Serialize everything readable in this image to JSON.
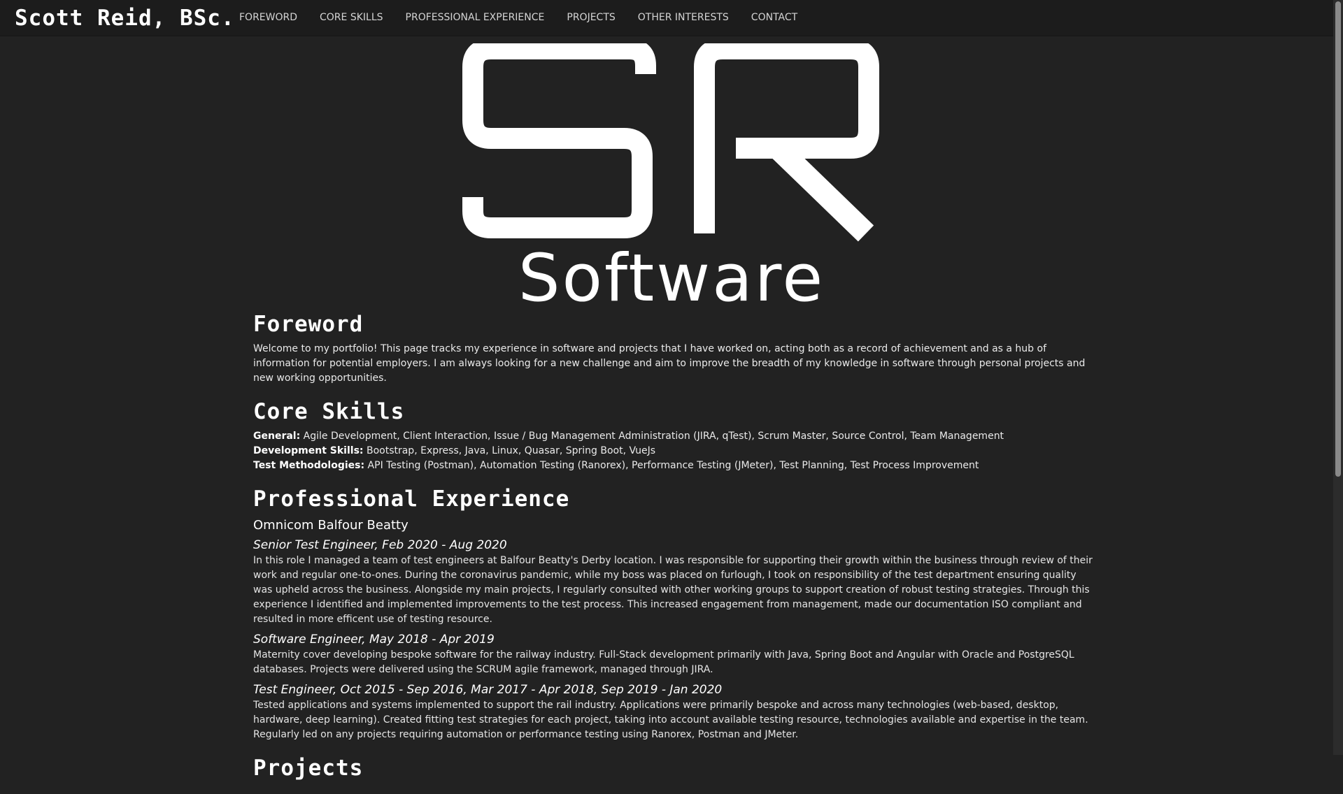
{
  "nav": {
    "brand": "Scott Reid, BSc.",
    "links": [
      "FOREWORD",
      "CORE SKILLS",
      "PROFESSIONAL EXPERIENCE",
      "PROJECTS",
      "OTHER INTERESTS",
      "CONTACT"
    ]
  },
  "logo": {
    "monogram": "SR",
    "wordmark": "Software"
  },
  "foreword": {
    "heading": "Foreword",
    "text": "Welcome to my portfolio! This page tracks my experience in software and projects that I have worked on, acting both as a record of achievement and as a hub of information for potential employers. I am always looking for a new challenge and aim to improve the breadth of my knowledge in software through personal projects and new working opportunities."
  },
  "core_skills": {
    "heading": "Core Skills",
    "items": [
      {
        "label": "General:",
        "value": " Agile Development, Client Interaction, Issue / Bug Management Administration (JIRA, qTest), Scrum Master, Source Control, Team Management"
      },
      {
        "label": "Development Skills:",
        "value": " Bootstrap, Express, Java, Linux, Quasar, Spring Boot, VueJs"
      },
      {
        "label": "Test Methodologies:",
        "value": " API Testing (Postman), Automation Testing (Ranorex), Performance Testing (JMeter), Test Planning, Test Process Improvement"
      }
    ]
  },
  "experience": {
    "heading": "Professional Experience",
    "company": "Omnicom Balfour Beatty",
    "jobs": [
      {
        "title": "Senior Test Engineer, Feb 2020 - Aug 2020",
        "description": "In this role I managed a team of test engineers at Balfour Beatty's Derby location. I was responsible for supporting their growth within the business through review of their work and regular one-to-ones. During the coronavirus pandemic, while my boss was placed on furlough, I took on responsibility of the test department ensuring quality was upheld across the business. Alongside my main projects, I regularly consulted with other working groups to support creation of robust testing strategies. Through this experience I identified and implemented improvements to the test process. This increased engagement from management, made our documentation ISO compliant and resulted in more efficent use of testing resource."
      },
      {
        "title": "Software Engineer, May 2018 - Apr 2019",
        "description": "Maternity cover developing bespoke software for the railway industry. Full-Stack development primarily with Java, Spring Boot and Angular with Oracle and PostgreSQL databases. Projects were delivered using the SCRUM agile framework, managed through JIRA."
      },
      {
        "title": "Test Engineer, Oct 2015 - Sep 2016, Mar 2017 - Apr 2018, Sep 2019 - Jan 2020",
        "description": "Tested applications and systems implemented to support the rail industry. Applications were primarily bespoke and across many technologies (web-based, desktop, hardware, deep learning). Created fitting test strategies for each project, taking into account available testing resource, technologies available and expertise in the team. Regularly led on any projects requiring automation or performance testing using Ranorex, Postman and JMeter."
      }
    ]
  },
  "projects": {
    "heading": "Projects"
  }
}
